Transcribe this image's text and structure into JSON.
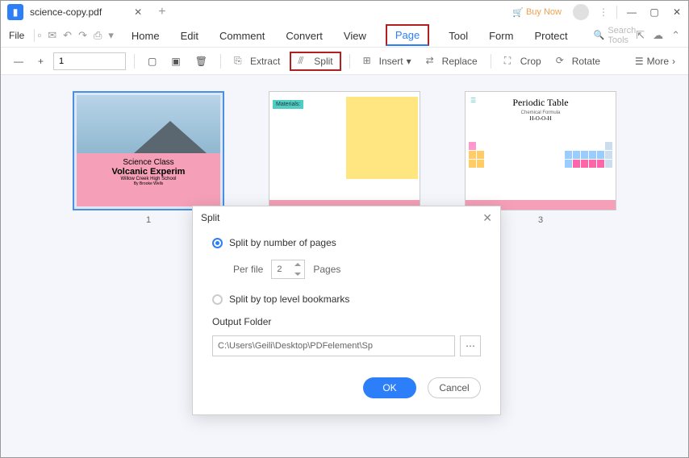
{
  "titlebar": {
    "filename": "science-copy.pdf",
    "buynow": "Buy Now"
  },
  "menubar": {
    "file": "File",
    "items": [
      "Home",
      "Edit",
      "Comment",
      "Convert",
      "View",
      "Page",
      "Tool",
      "Form",
      "Protect"
    ],
    "search_placeholder": "Search Tools"
  },
  "toolbar": {
    "zoom_value": "1",
    "extract": "Extract",
    "split": "Split",
    "insert": "Insert",
    "replace": "Replace",
    "crop": "Crop",
    "rotate": "Rotate",
    "more": "More"
  },
  "thumbs": {
    "p1": {
      "num": "1",
      "class_line": "Science Class",
      "title": "Volcanic Experim",
      "school": "Willow Creek High School",
      "author": "By Brooke Wells"
    },
    "p2": {
      "materials": "Materials:"
    },
    "p3": {
      "num": "3",
      "title": "Periodic Table",
      "sub": "Chemical Formula",
      "formula": "H-O-O-H"
    }
  },
  "modal": {
    "title": "Split",
    "opt1": "Split by number of pages",
    "perfile": "Per file",
    "perfile_value": "2",
    "pages": "Pages",
    "opt2": "Split by top level bookmarks",
    "output_label": "Output Folder",
    "output_path": "C:\\Users\\Geili\\Desktop\\PDFelement\\Sp",
    "ok": "OK",
    "cancel": "Cancel"
  }
}
